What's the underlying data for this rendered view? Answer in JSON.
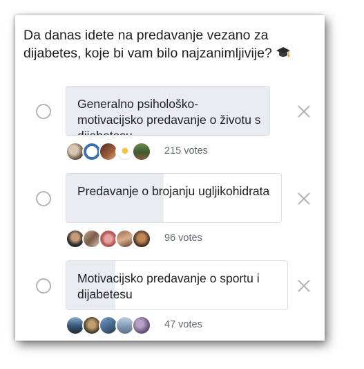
{
  "poll": {
    "question": "Da danas idete na predavanje vezano za dijabetes, koje bi vam bilo najzanimljivije?",
    "question_emoji": "graduation-cap-icon",
    "options": [
      {
        "label": "Generalno psihološko-motivacijsko predavanje o životu s dijabetesu",
        "votes_text": "215 votes",
        "vote_share": 1.0
      },
      {
        "label": "Predavanje o brojanju ugljikohidrata",
        "votes_text": "96 votes",
        "vote_share": 0.45
      },
      {
        "label": "Motivacijsko predavanje o sportu i dijabetesu",
        "votes_text": "47 votes",
        "vote_share": 0.22
      }
    ]
  },
  "colors": {
    "fill": "#e9ebf2",
    "border": "#dddfe2",
    "radio": "#b0b3b8",
    "text": "#1c1e21",
    "secondary_text": "#606770"
  }
}
